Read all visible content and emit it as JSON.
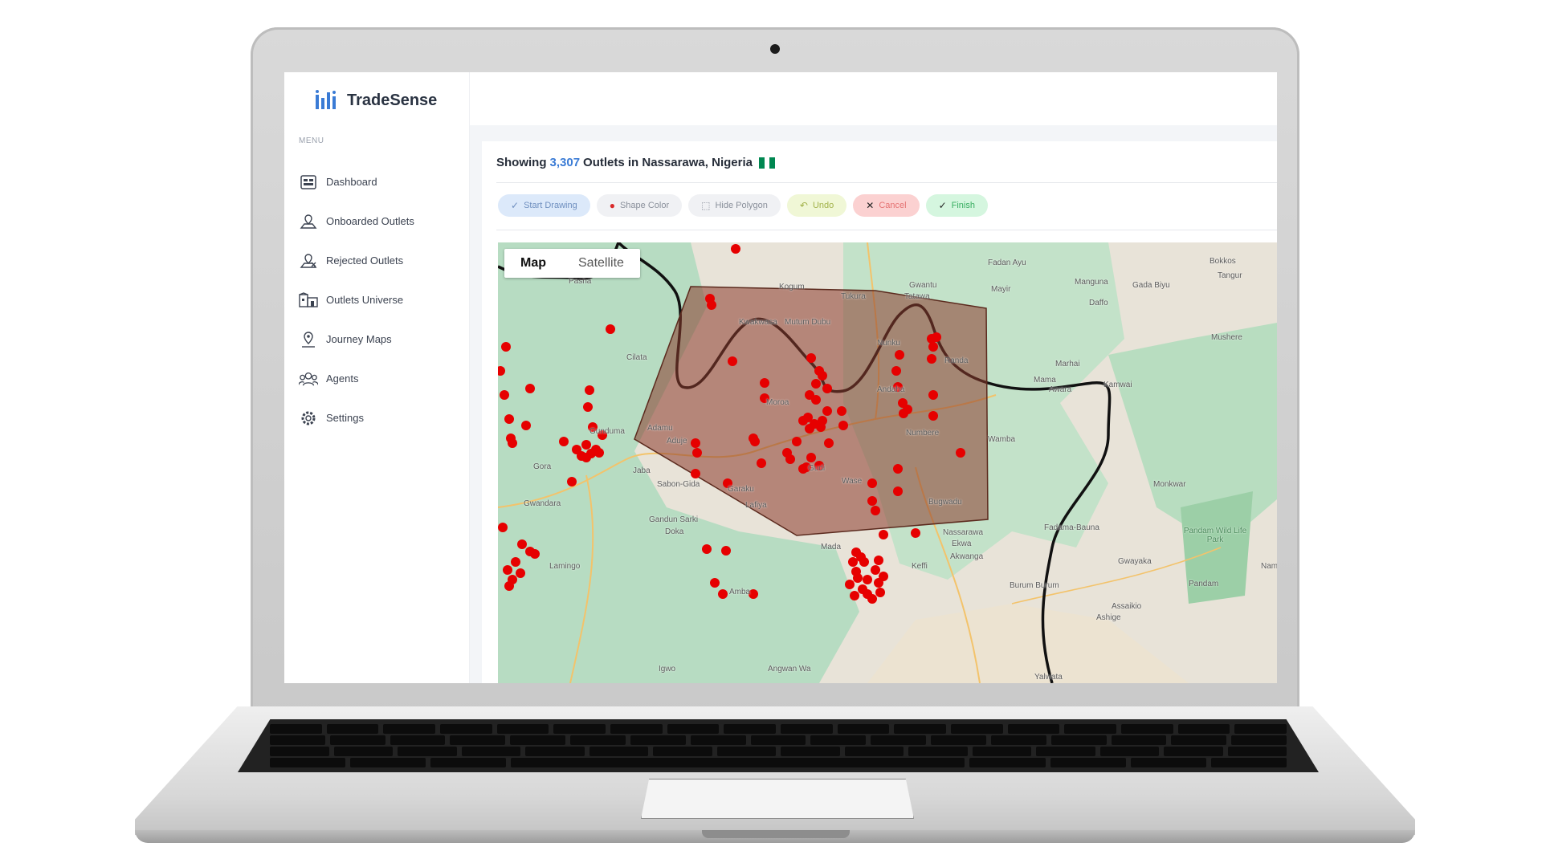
{
  "app": {
    "brand_name": "TradeSense"
  },
  "sidebar": {
    "menu_label": "MENU",
    "items": [
      {
        "label": "Dashboard",
        "icon": "dashboard-icon"
      },
      {
        "label": "Onboarded Outlets",
        "icon": "onboarded-outlets-icon"
      },
      {
        "label": "Rejected Outlets",
        "icon": "rejected-outlets-icon"
      },
      {
        "label": "Outlets Universe",
        "icon": "outlets-universe-icon"
      },
      {
        "label": "Journey Maps",
        "icon": "journey-maps-icon"
      },
      {
        "label": "Agents",
        "icon": "agents-icon"
      },
      {
        "label": "Settings",
        "icon": "settings-icon"
      }
    ]
  },
  "header": {
    "prefix": "Showing",
    "count": "3,307",
    "suffix": "Outlets in Nassarawa, Nigeria",
    "flag": [
      "#008751",
      "#ffffff",
      "#008751"
    ]
  },
  "toolbar": {
    "start_drawing": "Start Drawing",
    "shape_color": "Shape Color",
    "hide_polygon": "Hide Polygon",
    "undo": "Undo",
    "cancel": "Cancel",
    "finish": "Finish"
  },
  "map": {
    "map_tab": "Map",
    "satellite_tab": "Satellite",
    "places": [
      "Fadan Ayu",
      "Gwantu",
      "Bokkos",
      "Tangur",
      "Kogum",
      "Tukura",
      "Tatawa",
      "Mayir",
      "Manguna",
      "Gada Biyu",
      "Daffo",
      "Pasha",
      "Kwakwasa",
      "Mutum Dubu",
      "Mushere",
      "Nunku",
      "Cilata",
      "Randa",
      "Marhai",
      "Mama",
      "Awara",
      "Kamwai",
      "Moroa",
      "Andaha",
      "Adamu",
      "Gunduma",
      "Numbere",
      "Wamba",
      "Aduje",
      "Gora",
      "Jaba",
      "Garaku",
      "Gudi",
      "Wase",
      "Sabon-Gida",
      "Gwandara",
      "Gandun Sarki",
      "Doka",
      "Lafiya",
      "Bugwadu",
      "Fadama-Bauna",
      "Nassarawa",
      "Ekwa",
      "Akwanga",
      "Keffi",
      "Lamingo",
      "Mada",
      "Gwayaka",
      "Burum Burum",
      "Pandam",
      "Amba",
      "Assaikio",
      "Ashige",
      "Igwo",
      "Angwan Wa",
      "Yalwata",
      "Monkwar",
      "Pandam Wild Life Park",
      "Namu"
    ]
  },
  "colors": {
    "accent": "#3a7bd5",
    "outlet_marker": "#e60000",
    "polygon_fill": "#8b3a2b",
    "boundary": "#111111"
  }
}
